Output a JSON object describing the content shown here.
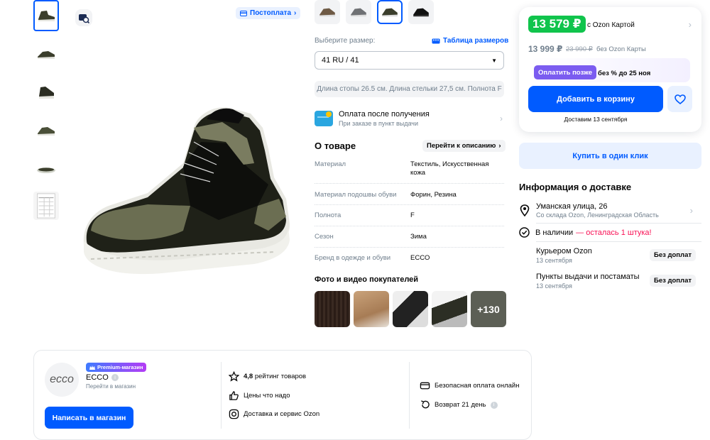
{
  "gallery": {
    "thumb_icons": [
      "shoe-side-thumb",
      "shoe-side-thumb",
      "shoe-back-thumb",
      "shoe-front-thumb",
      "shoe-sole-thumb",
      "size-chart-thumb"
    ],
    "postoplata_label": "Постоплата"
  },
  "variants": [
    "brown",
    "grey",
    "olive",
    "black"
  ],
  "size": {
    "label": "Выберите размер:",
    "table_link": "Таблица размеров",
    "selected": "41 RU / 41",
    "note": "Длина стопы 26.5 см. Длина стельки 27,5 см. Полнота F"
  },
  "payment_after": {
    "title": "Оплата после получения",
    "subtitle": "При заказе в пункт выдачи"
  },
  "about": {
    "title": "О товаре",
    "to_description": "Перейти к описанию",
    "specs": [
      {
        "k": "Материал",
        "v": "Текстиль, Искусственная кожа"
      },
      {
        "k": "Материал подошвы обуви",
        "v": "Форин, Резина"
      },
      {
        "k": "Полнота",
        "v": "F"
      },
      {
        "k": "Сезон",
        "v": "Зима"
      },
      {
        "k": "Бренд в одежде и обуви",
        "v": "ECCO"
      }
    ]
  },
  "customer_photos": {
    "title": "Фото и видео покупателей",
    "more": "+130"
  },
  "price": {
    "ozon_price": "13 579 ₽",
    "ozon_label": "с Ozon Картой",
    "price": "13 999 ₽",
    "old_price": "23 990 ₽",
    "no_ozon_label": "без Ozon Карты",
    "pay_later_btn": "Оплатить позже",
    "pay_later_text": "без % до 25 ноя",
    "cart_btn": "Добавить в корзину",
    "deliver_date": "Доставим 13 сентября",
    "one_click": "Купить в один клик"
  },
  "delivery": {
    "title": "Информация о доставке",
    "address": "Уманская улица, 26",
    "address_sub": "Со склада Ozon, Ленинградская Область",
    "stock_prefix": "В наличии",
    "stock_warn": "— осталась 1 штука!",
    "options": [
      {
        "t": "Курьером Ozon",
        "s": "13 сентября",
        "badge": "Без доплат"
      },
      {
        "t": "Пункты выдачи и постаматы",
        "s": "13 сентября",
        "badge": "Без доплат"
      }
    ]
  },
  "seller": {
    "logo_text": "ecco",
    "premium": "Premium-магазин",
    "name": "ECCO",
    "sub": "Перейти в магазин",
    "write_btn": "Написать в магазин",
    "rating_value": "4,8",
    "rating_label": "рейтинг товаров",
    "feat2": "Цены что надо",
    "feat3": "Доставка и сервис Ozon",
    "feat4": "Безопасная оплата онлайн",
    "feat5": "Возврат 21 день"
  }
}
